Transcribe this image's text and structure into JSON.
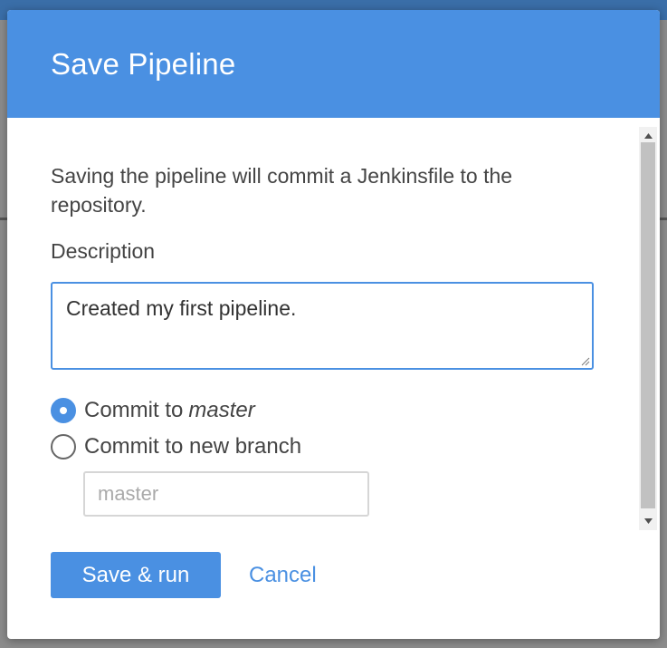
{
  "dialog": {
    "title": "Save Pipeline",
    "intro": "Saving the pipeline will commit a Jenkinsfile to the repository.",
    "description_label": "Description",
    "description_value": "Created my first pipeline.",
    "commit_options": [
      {
        "label": "Commit to",
        "emphasis": "master",
        "selected": true
      },
      {
        "label": "Commit to new branch",
        "emphasis": "",
        "selected": false
      }
    ],
    "branch_placeholder": "master",
    "save_label": "Save & run",
    "cancel_label": "Cancel"
  },
  "colors": {
    "accent": "#4a90e2",
    "header_bg": "#4a90e2",
    "text": "#444444"
  },
  "icons": {
    "scroll_up": "triangle-up-icon",
    "scroll_down": "triangle-down-icon",
    "resize": "resize-grip-icon"
  }
}
